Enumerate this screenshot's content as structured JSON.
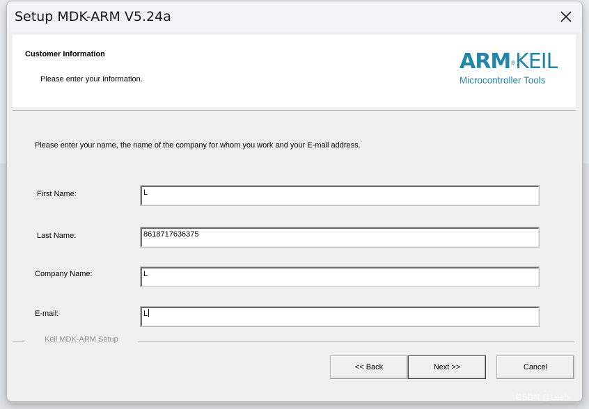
{
  "window": {
    "title": "Setup MDK-ARM V5.24a"
  },
  "header": {
    "title": "Customer Information",
    "subtitle": "Please enter your information.",
    "logo": {
      "brand_arm": "ARM",
      "brand_reg": "®",
      "brand_keil": "KEIL",
      "tagline": "Microcontroller Tools"
    }
  },
  "instruction": "Please enter your name, the name of the company for whom you work and your E-mail address.",
  "form": {
    "first_name": {
      "label": "First Name:",
      "value": "L"
    },
    "last_name": {
      "label": "Last Name:",
      "value": "8618717636375"
    },
    "company_name": {
      "label": "Company Name:",
      "value": "L"
    },
    "email": {
      "label": "E-mail:",
      "value": "L"
    }
  },
  "footer": {
    "group_label": "Keil MDK-ARM Setup",
    "back_label": "<< Back",
    "next_label": "Next >>",
    "cancel_label": "Cancel"
  },
  "watermark": "CSDN @Leah-",
  "colors": {
    "brand": "#2286a8",
    "dialog_bg": "#f0f0f0",
    "header_bg": "#ffffff"
  },
  "icons": {
    "close": "close-icon"
  }
}
